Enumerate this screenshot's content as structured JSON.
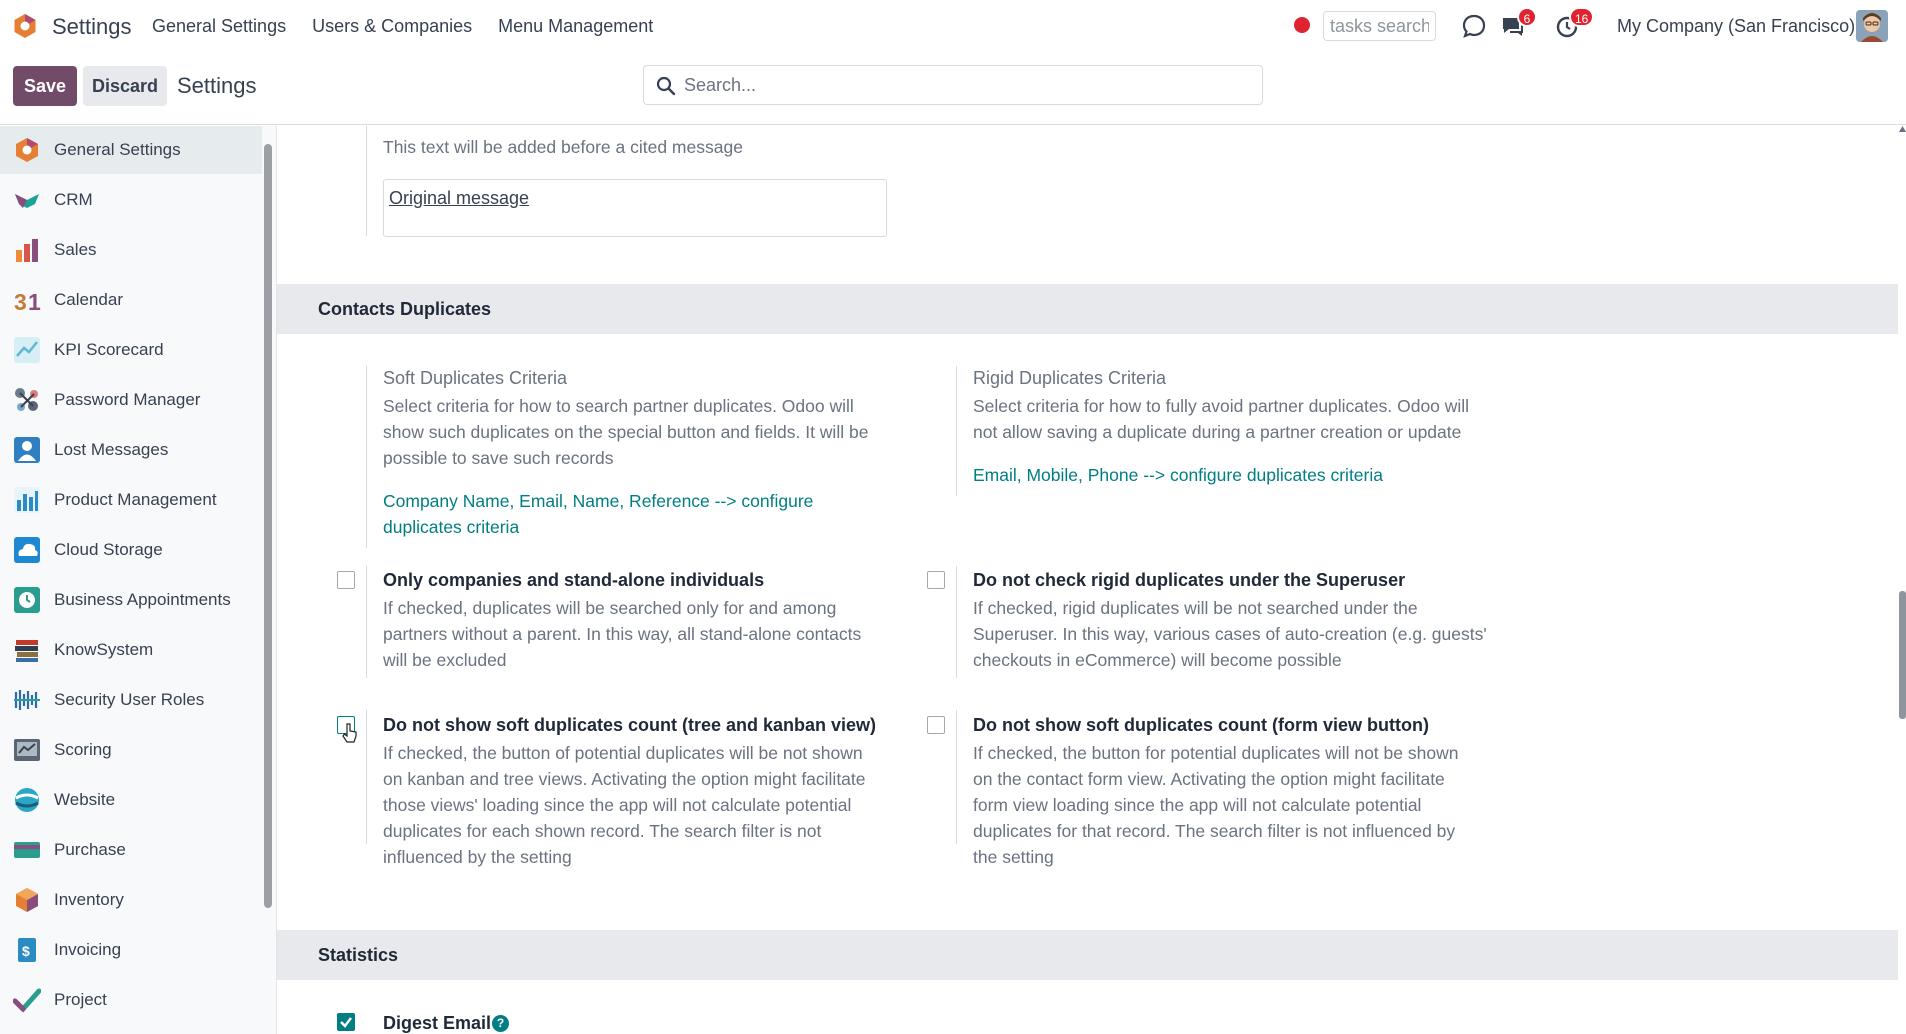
{
  "topbar": {
    "app_title": "Settings",
    "menu": [
      "General Settings",
      "Users & Companies",
      "Menu Management"
    ],
    "tasks_search_placeholder": "tasks search",
    "messages_badge": "6",
    "activities_badge": "16",
    "company": "My Company (San Francisco)"
  },
  "control_panel": {
    "save_label": "Save",
    "discard_label": "Discard",
    "breadcrumb": "Settings",
    "search_placeholder": "Search..."
  },
  "sidebar": {
    "items": [
      {
        "label": "General Settings",
        "icon": "settings-app-icon",
        "active": true
      },
      {
        "label": "CRM",
        "icon": "crm-app-icon"
      },
      {
        "label": "Sales",
        "icon": "sales-app-icon"
      },
      {
        "label": "Calendar",
        "icon": "calendar-app-icon"
      },
      {
        "label": "KPI Scorecard",
        "icon": "kpi-scorecard-app-icon"
      },
      {
        "label": "Password Manager",
        "icon": "password-manager-app-icon"
      },
      {
        "label": "Lost Messages",
        "icon": "lost-messages-app-icon"
      },
      {
        "label": "Product Management",
        "icon": "product-management-app-icon"
      },
      {
        "label": "Cloud Storage",
        "icon": "cloud-storage-app-icon"
      },
      {
        "label": "Business Appointments",
        "icon": "business-appointments-app-icon"
      },
      {
        "label": "KnowSystem",
        "icon": "knowsystem-app-icon"
      },
      {
        "label": "Security User Roles",
        "icon": "security-user-roles-app-icon"
      },
      {
        "label": "Scoring",
        "icon": "scoring-app-icon"
      },
      {
        "label": "Website",
        "icon": "website-app-icon"
      },
      {
        "label": "Purchase",
        "icon": "purchase-app-icon"
      },
      {
        "label": "Inventory",
        "icon": "inventory-app-icon"
      },
      {
        "label": "Invoicing",
        "icon": "invoicing-app-icon"
      },
      {
        "label": "Project",
        "icon": "project-app-icon"
      }
    ]
  },
  "cited_message": {
    "description": "This text will be added before a cited message",
    "value": "Original message"
  },
  "contacts_duplicates": {
    "title": "Contacts Duplicates",
    "soft": {
      "label": "Soft Duplicates Criteria",
      "desc1": "Select criteria for how to search partner duplicates. Odoo will",
      "desc2": "show such duplicates on the special button and fields. It will be",
      "desc3": "possible to save such records",
      "link1": "Company Name, Email, Name, Reference --> configure",
      "link2": "duplicates criteria"
    },
    "rigid": {
      "label": "Rigid Duplicates Criteria",
      "desc1": "Select criteria for how to fully avoid partner duplicates. Odoo will",
      "desc2": "not allow saving a duplicate during a partner creation or update",
      "link1": "Email, Mobile, Phone --> configure duplicates criteria"
    },
    "only_companies": {
      "title": "Only companies and stand-alone individuals",
      "desc1": "If checked, duplicates will be searched only for and among",
      "desc2": "partners without a parent. In this way, all stand-alone contacts",
      "desc3": "will be excluded",
      "checked": false
    },
    "no_rigid_superuser": {
      "title": "Do not check rigid duplicates under the Superuser",
      "desc1": "If checked, rigid duplicates will be not searched under the",
      "desc2": "Superuser. In this way, various cases of auto-creation (e.g. guests'",
      "desc3": "checkouts in eCommerce) will become possible",
      "checked": false
    },
    "no_soft_tree": {
      "title": "Do not show soft duplicates count (tree and kanban view)",
      "desc1": "If checked, the button of potential duplicates will be not shown",
      "desc2": "on kanban and tree views. Activating the option might facilitate",
      "desc3": "those views' loading since the app will not calculate potential",
      "desc4": "duplicates for each shown record. The search filter is not",
      "desc5": "influenced by the setting",
      "checked": false
    },
    "no_soft_form": {
      "title": "Do not show soft duplicates count (form view button)",
      "desc1": "If checked, the button for potential duplicates will not be shown",
      "desc2": "on the contact form view. Activating the option might facilitate",
      "desc3": "form view loading since the app will not calculate potential",
      "desc4": "duplicates for that record. The search filter is not influenced by",
      "desc5": "the setting",
      "checked": false
    }
  },
  "statistics": {
    "title": "Statistics",
    "digest_email": {
      "title": "Digest Email",
      "checked": true
    }
  },
  "colors": {
    "brand": "#714b67",
    "link": "#017e84",
    "badge": "#e0242f",
    "section_bg": "#e7e9ed"
  }
}
